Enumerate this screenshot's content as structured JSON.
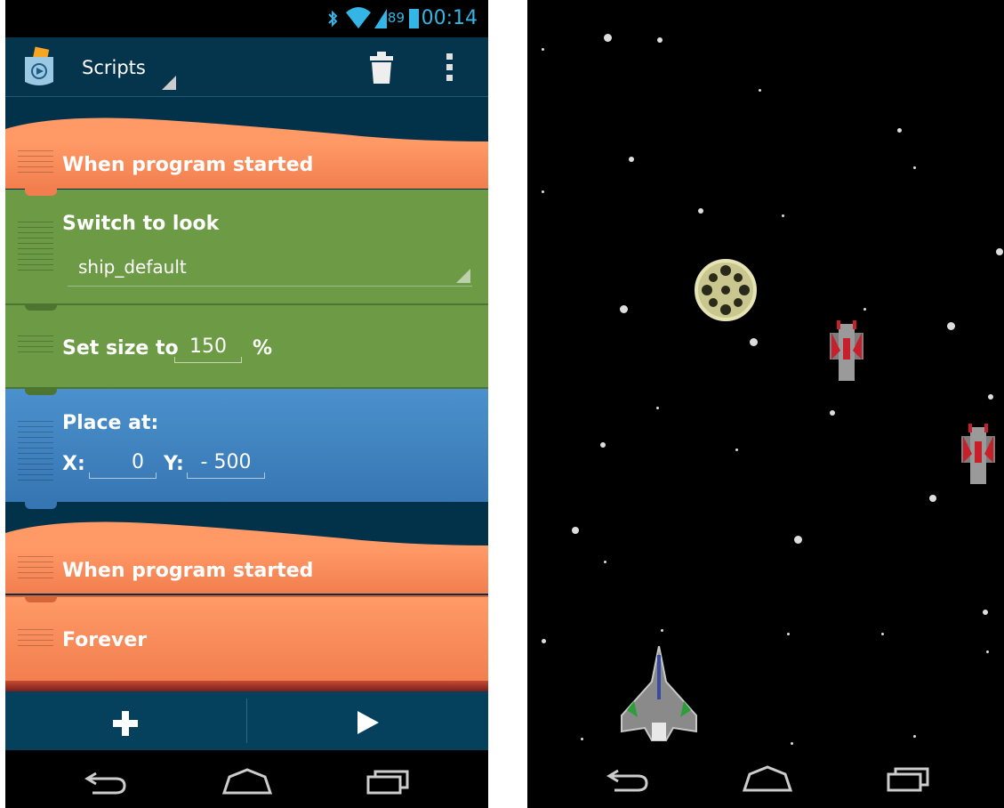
{
  "status_bar": {
    "battery": "89",
    "time": "00:14"
  },
  "action_bar": {
    "title": "Scripts",
    "icons": [
      "pocket-code-icon",
      "trash-icon",
      "overflow-menu-icon"
    ]
  },
  "bricks": [
    {
      "type": "event",
      "label": "When program started"
    },
    {
      "type": "look",
      "label": "Switch to look",
      "look_value": "ship_default"
    },
    {
      "type": "look",
      "label": "Set size to",
      "size_value": "150",
      "unit": "%"
    },
    {
      "type": "motion",
      "label": "Place at:",
      "x_label": "X:",
      "x_value": "0",
      "y_label": "Y:",
      "y_value": "- 500"
    },
    {
      "type": "event",
      "label": "When program started"
    },
    {
      "type": "control",
      "label": "Forever"
    }
  ],
  "bottom_bar": {
    "icons": [
      "add-icon",
      "play-icon"
    ]
  },
  "navigation": {
    "icons": [
      "back-icon",
      "home-icon",
      "recents-icon"
    ]
  },
  "colors": {
    "event": "#f68a5a",
    "look": "#6c9a45",
    "motion": "#3f82c2",
    "accent": "#33b5e5",
    "app_bg": "#02324a"
  }
}
